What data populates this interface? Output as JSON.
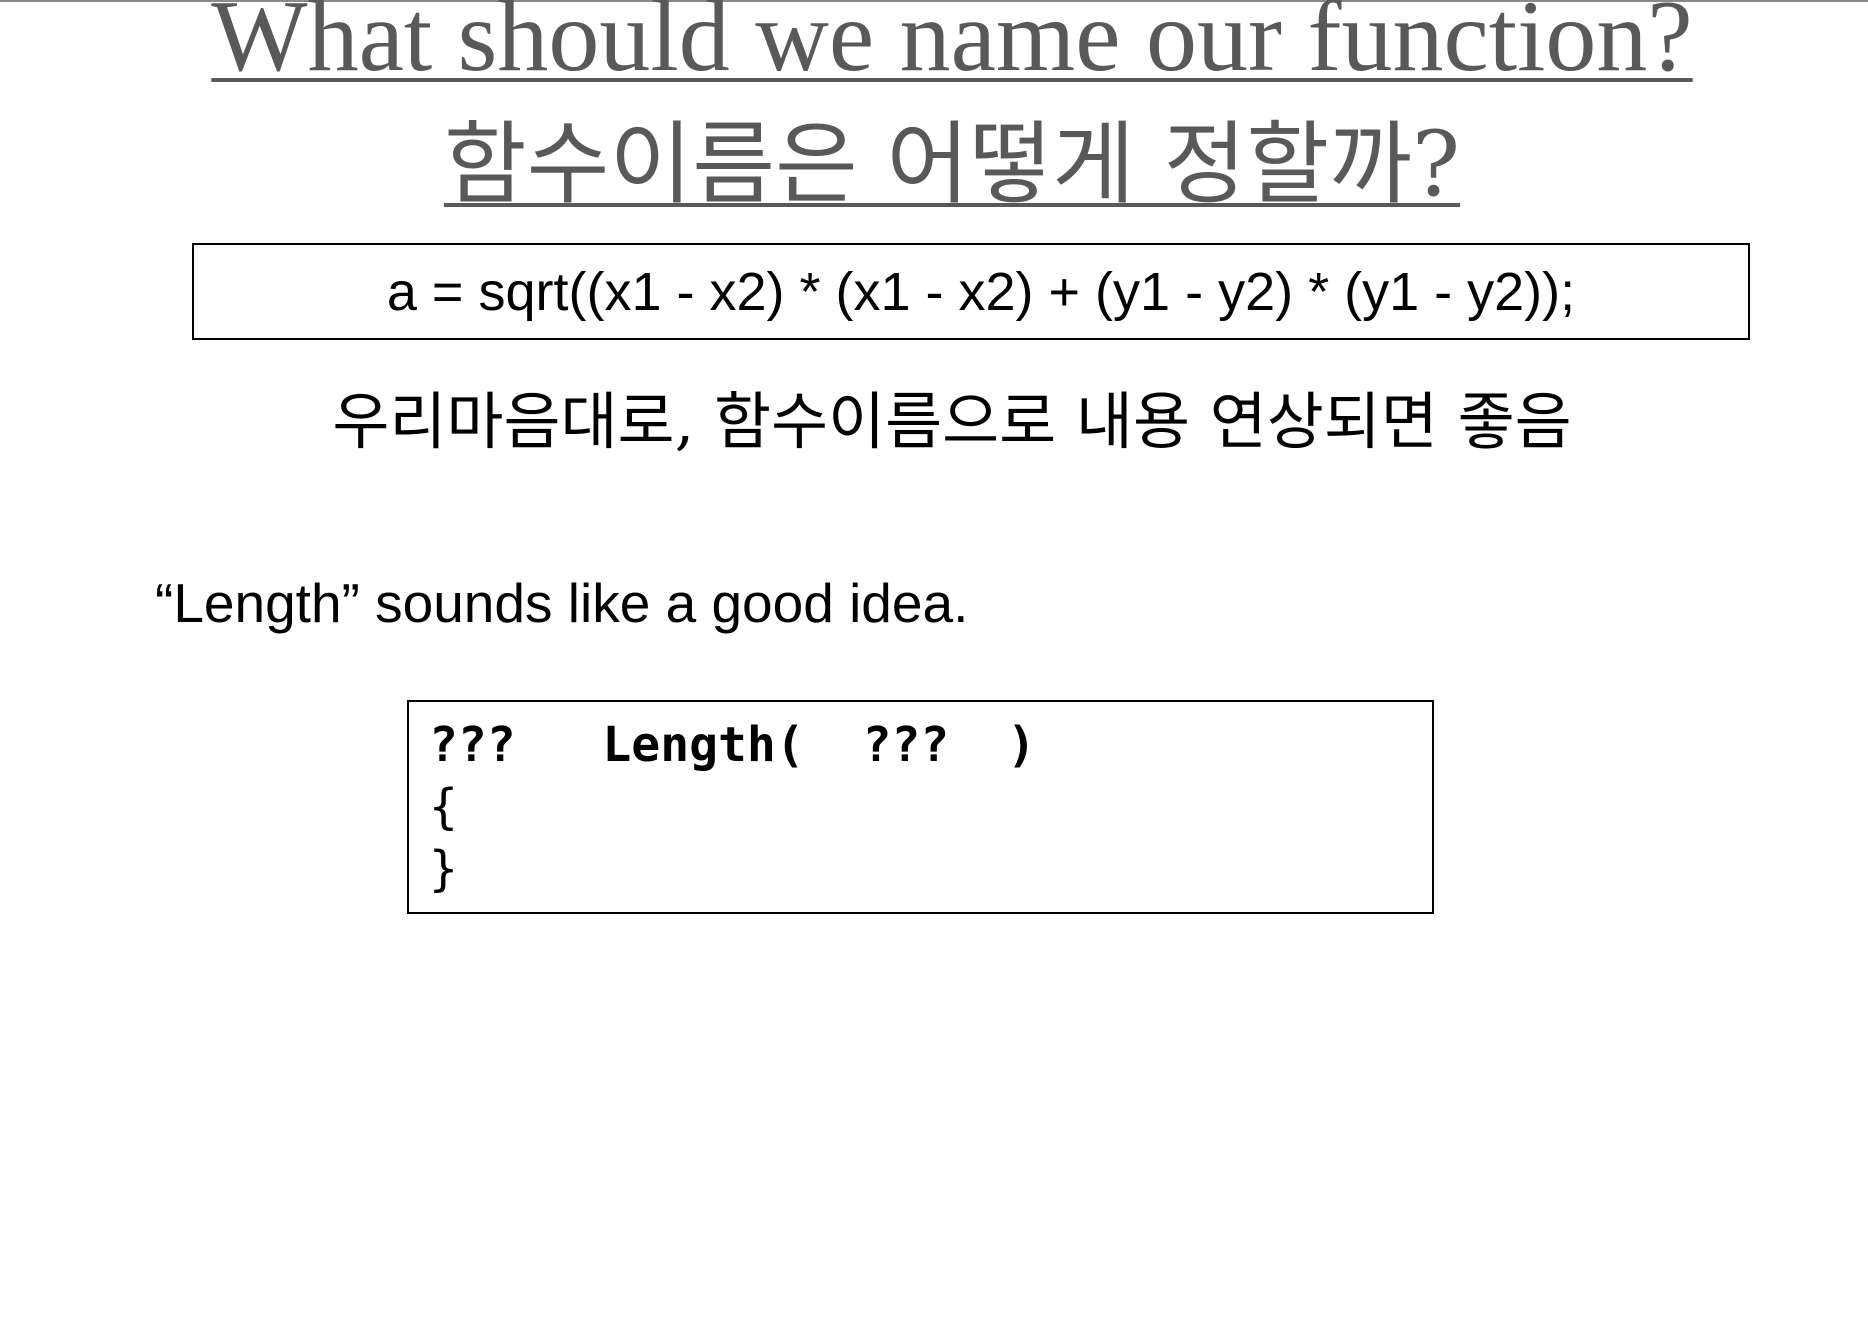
{
  "slide": {
    "title_en": "What should we name our function?",
    "title_ko": "함수이름은 어떻게 정할까?",
    "formula": "a = sqrt((x1 - x2) * (x1 - x2) + (y1 - y2) * (y1 - y2));",
    "subtitle_ko": "우리마음대로, 함수이름으로 내용 연상되면 좋음",
    "note": "“Length” sounds like a good idea.",
    "code": {
      "return_type": "???",
      "function_name": "Length(",
      "params": "???",
      "close_paren": ")",
      "open_brace": "{",
      "close_brace": "}"
    }
  }
}
